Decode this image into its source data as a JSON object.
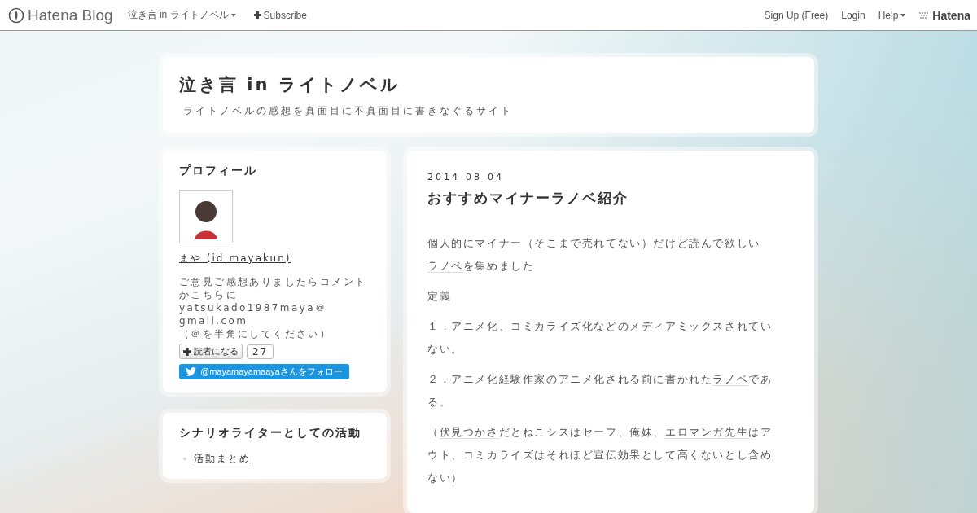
{
  "topbar": {
    "logo": "Hatena Blog",
    "blog_menu": "泣き言 in ライトノベル",
    "subscribe": "Subscribe",
    "right": [
      "Sign Up (Free)",
      "Login"
    ],
    "help": "Help",
    "brand": "Hatena"
  },
  "header": {
    "title": "泣き言 in ライトノベル",
    "description": "ライトノベルの感想を真面目に不真面目に書きなぐるサイト"
  },
  "profile": {
    "heading": "プロフィール",
    "name": "まや (id:mayakun)",
    "description": [
      "ご意見ご感想ありましたらコメントかこちらにyatsukado1987maya＠gmail.com",
      "（＠を半角にしてください）"
    ],
    "reader_button": "読者になる",
    "reader_count": "27",
    "twitter_button": "@mayamayamaayaさんをフォロー"
  },
  "activity": {
    "heading": "シナリオライターとしての活動",
    "items": [
      {
        "marker": "◦",
        "text": "活動まとめ"
      }
    ]
  },
  "article": {
    "date": "2014-08-04",
    "title": "おすすめマイナーラノベ紹介",
    "paragraphs": [
      [
        {
          "text": "個人的にマイナー（そこまで売れてない）だけど読んで欲しい",
          "link": false
        },
        {
          "text": "ラノベ",
          "link": true
        },
        {
          "text": "を集めました",
          "link": false
        }
      ],
      [
        {
          "text": " 定義",
          "link": false
        }
      ],
      [
        {
          "text": "１．アニメ化、コミカライズ化などのメディアミックスされていない。",
          "link": false
        }
      ],
      [
        {
          "text": "２．アニメ化経験作家のアニメ化される前に書かれた",
          "link": false
        },
        {
          "text": "ラノベ",
          "link": true
        },
        {
          "text": "である。",
          "link": false
        }
      ],
      [
        {
          "text": "（",
          "link": false
        },
        {
          "text": "伏見つかさ",
          "link": true
        },
        {
          "text": "だとねこシスはセーフ、俺妹、",
          "link": false
        },
        {
          "text": "エロマンガ先生",
          "link": true
        },
        {
          "text": "はアウト、コミカライズはそれほど宣伝効果として高くないとし含めない）",
          "link": false
        }
      ]
    ]
  }
}
